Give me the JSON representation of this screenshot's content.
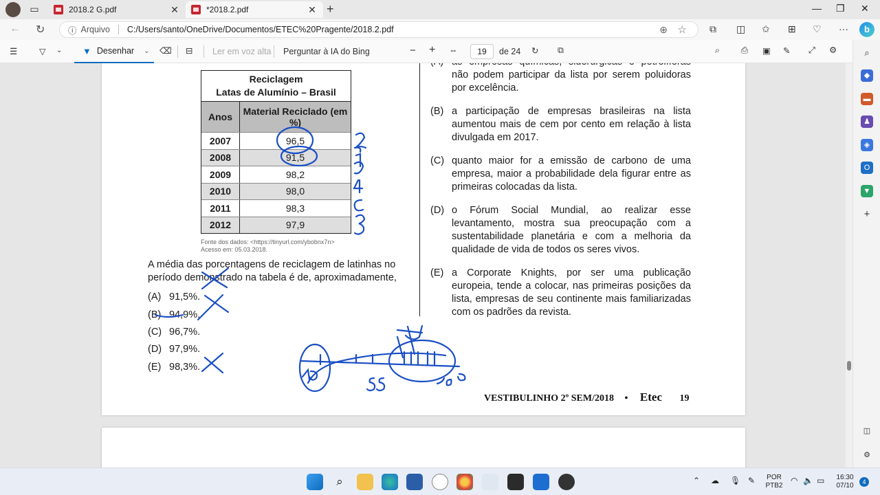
{
  "browser": {
    "tabs": [
      {
        "label": "2018.2 G.pdf"
      },
      {
        "label": "*2018.2.pdf"
      }
    ],
    "address": {
      "info_label": "Arquivo",
      "url": "C:/Users/santo/OneDrive/Documentos/ETEC%20Pragente/2018.2.pdf"
    }
  },
  "pdf_toolbar": {
    "draw_label": "Desenhar",
    "read_aloud_label": "Ler em voz alta",
    "ask_bing_label": "Perguntar à IA do Bing",
    "page_current": "19",
    "page_total": "de 24"
  },
  "document": {
    "table": {
      "title_line1": "Reciclagem",
      "title_line2": "Latas de Alumínio – Brasil",
      "col1_header": "Anos",
      "col2_header": "Material Reciclado (em %)",
      "rows": [
        {
          "year": "2007",
          "value": "96,5"
        },
        {
          "year": "2008",
          "value": "91,5"
        },
        {
          "year": "2009",
          "value": "98,2"
        },
        {
          "year": "2010",
          "value": "98,0"
        },
        {
          "year": "2011",
          "value": "98,3"
        },
        {
          "year": "2012",
          "value": "97,9"
        }
      ],
      "source_line1": "Fonte dos dados: <https://tinyurl.com/ybobnx7n>",
      "source_line2": "Acesso em: 05.03.2018."
    },
    "question": "A média das porcentagens de reciclagem de latinhas no período demonstrado na tabela é de, aproximadamente,",
    "options": [
      {
        "letter": "(A)",
        "text": "91,5%."
      },
      {
        "letter": "(B)",
        "text": "94,9%."
      },
      {
        "letter": "(C)",
        "text": "96,7%."
      },
      {
        "letter": "(D)",
        "text": "97,9%."
      },
      {
        "letter": "(E)",
        "text": "98,3%."
      }
    ],
    "right_options": [
      {
        "letter": "(A)",
        "text": "as empresas químicas, siderúrgicas e petrolíferas não podem participar da lista por serem poluidoras por excelência."
      },
      {
        "letter": "(B)",
        "text": "a participação de empresas brasileiras na lista aumentou mais de cem por cento em relação à lista divulgada em 2017."
      },
      {
        "letter": "(C)",
        "text": "quanto maior for a emissão de carbono de uma empresa, maior a probabilidade dela figurar entre as primeiras colocadas da lista."
      },
      {
        "letter": "(D)",
        "text": "o Fórum Social Mundial, ao realizar esse levantamento, mostra sua preocupação com a sustentabilidade planetária e com a melhoria da qualidade de vida de todos os seres vivos."
      },
      {
        "letter": "(E)",
        "text": "a Corporate Knights, por ser uma publicação europeia, tende a colocar, nas primeiras posições da lista, empresas de seu continente mais familiarizadas com os padrões da revista."
      }
    ],
    "footer": {
      "exam": "VESTIBULINHO 2º SEM/2018",
      "bullet": "•",
      "brand": "Etec",
      "page": "19"
    }
  },
  "taskbar": {
    "lang": "POR",
    "layout": "PTB2",
    "time": "16:30",
    "date": "07/10",
    "badge": "4"
  },
  "colors": {
    "accent": "#0f6cbd",
    "ink": "#1a4fc4",
    "pdf_red": "#c4262e",
    "table_header": "#bdbdbd",
    "table_stripe": "#dedede"
  },
  "icons": [
    "back-icon",
    "refresh-icon",
    "info-icon",
    "zoom-icon",
    "favorite-star-icon",
    "extensions-icon",
    "split-screen-icon",
    "favorites-icon",
    "collections-icon",
    "more-icon",
    "bing-copilot-icon",
    "contents-icon",
    "highlight-icon",
    "draw-pen-icon",
    "eraser-icon",
    "text-icon",
    "zoom-out-icon",
    "zoom-in-icon",
    "fit-width-icon",
    "rotate-icon",
    "page-view-icon",
    "search-icon",
    "print-icon",
    "save-icon",
    "save-as-icon",
    "fullscreen-icon",
    "settings-icon"
  ]
}
